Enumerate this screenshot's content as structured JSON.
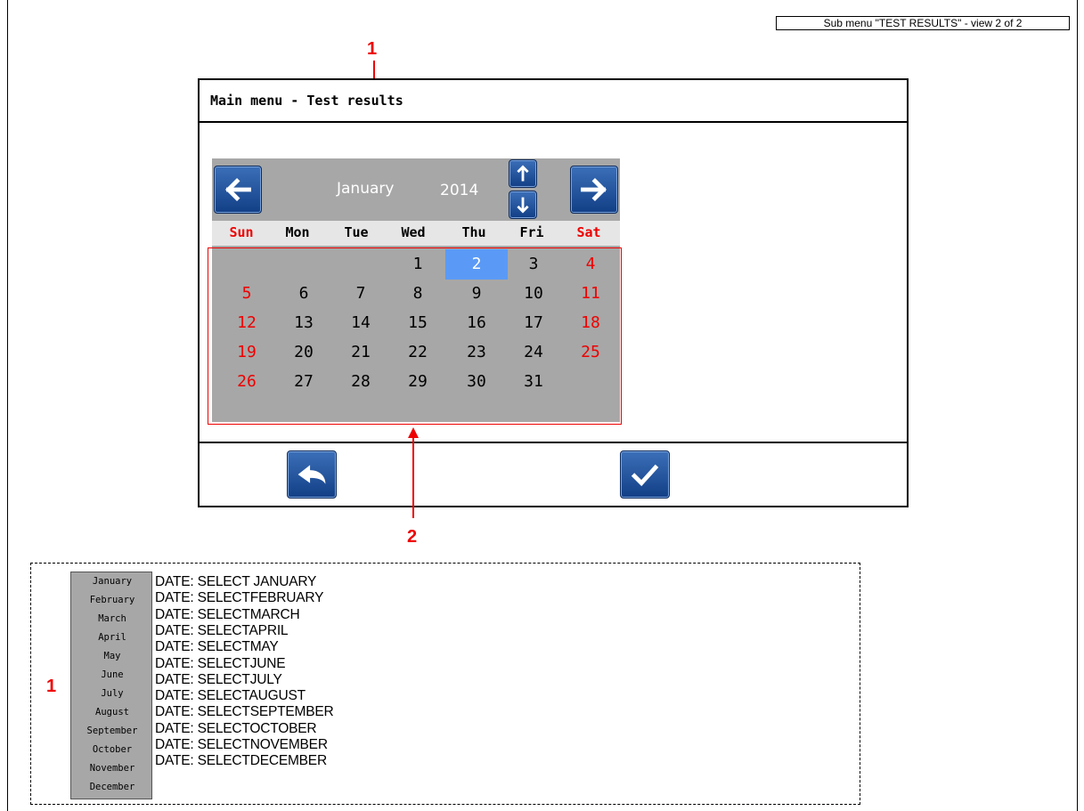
{
  "subtitle": "Sub menu \"TEST RESULTS\" - view 2 of 2",
  "callouts": {
    "one_top": "1",
    "two": "2",
    "one_legend": "1"
  },
  "screen": {
    "title": "Main menu - Test results",
    "calendar": {
      "month": "January",
      "year": "2014",
      "day_names": [
        "Sun",
        "Mon",
        "Tue",
        "Wed",
        "Thu",
        "Fri",
        "Sat"
      ],
      "weekend_color": "#e00000",
      "selected_color": "#5a9af6",
      "weeks": [
        [
          "",
          "",
          "",
          "1",
          "2",
          "3",
          "4"
        ],
        [
          "5",
          "6",
          "7",
          "8",
          "9",
          "10",
          "11"
        ],
        [
          "12",
          "13",
          "14",
          "15",
          "16",
          "17",
          "18"
        ],
        [
          "19",
          "20",
          "21",
          "22",
          "23",
          "24",
          "25"
        ],
        [
          "26",
          "27",
          "28",
          "29",
          "30",
          "31",
          ""
        ]
      ],
      "selected_day": "2",
      "icons": {
        "prev": "arrow-left-icon",
        "next": "arrow-right-icon",
        "up": "arrow-up-icon",
        "down": "arrow-down-icon"
      }
    },
    "footer": {
      "back_icon": "back-arrow-icon",
      "confirm_icon": "checkmark-icon"
    }
  },
  "legend": {
    "months": [
      "January",
      "February",
      "March",
      "April",
      "May",
      "June",
      "July",
      "August",
      "September",
      "October",
      "November",
      "December"
    ],
    "descriptions": [
      "DATE: SELECT JANUARY",
      "DATE: SELECTFEBRUARY",
      "DATE: SELECTMARCH",
      "DATE: SELECTAPRIL",
      "DATE: SELECTMAY",
      "DATE: SELECTJUNE",
      "DATE: SELECTJULY",
      "DATE: SELECTAUGUST",
      "DATE: SELECTSEPTEMBER",
      "DATE: SELECTOCTOBER",
      "DATE: SELECTNOVEMBER",
      "DATE: SELECTDECEMBER"
    ]
  }
}
